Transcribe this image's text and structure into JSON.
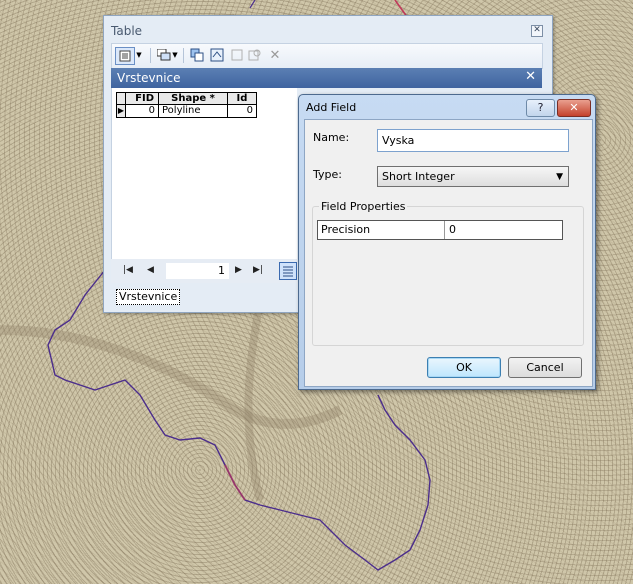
{
  "colors": {
    "map_bg": "#cfc6a9",
    "contour_line": "#4b2d8c",
    "contour_highlight": "#c0395a",
    "tab_header": "#4a6fa8"
  },
  "table_window": {
    "title": "Table",
    "close_icon": "close-icon",
    "toolbar": {
      "icons": [
        "table-options-icon",
        "dropdown-arrow-icon",
        "related-tables-icon",
        "select-by-attributes-icon",
        "switch-selection-icon",
        "clear-selection-icon",
        "zoom-to-selected-icon",
        "delete-selected-icon"
      ]
    },
    "tab_header": {
      "label": "Vrstevnice",
      "close": "✕"
    },
    "columns": [
      "FID",
      "Shape *",
      "Id"
    ],
    "rows": [
      {
        "selector": "▶",
        "fid": "0",
        "shape": "Polyline",
        "id": "0"
      }
    ],
    "nav": {
      "first": "|◀",
      "prev": "◀",
      "record": "1",
      "next": "▶",
      "last": "▶|"
    },
    "tab_strip": "Vrstevnice"
  },
  "add_field_dialog": {
    "title": "Add Field",
    "help": "?",
    "close": "✕",
    "name_label": "Name:",
    "name_value": "Vyska",
    "type_label": "Type:",
    "type_value": "Short Integer",
    "group_label": "Field Properties",
    "properties": [
      {
        "key": "Precision",
        "value": "0"
      }
    ],
    "ok": "OK",
    "cancel": "Cancel"
  }
}
